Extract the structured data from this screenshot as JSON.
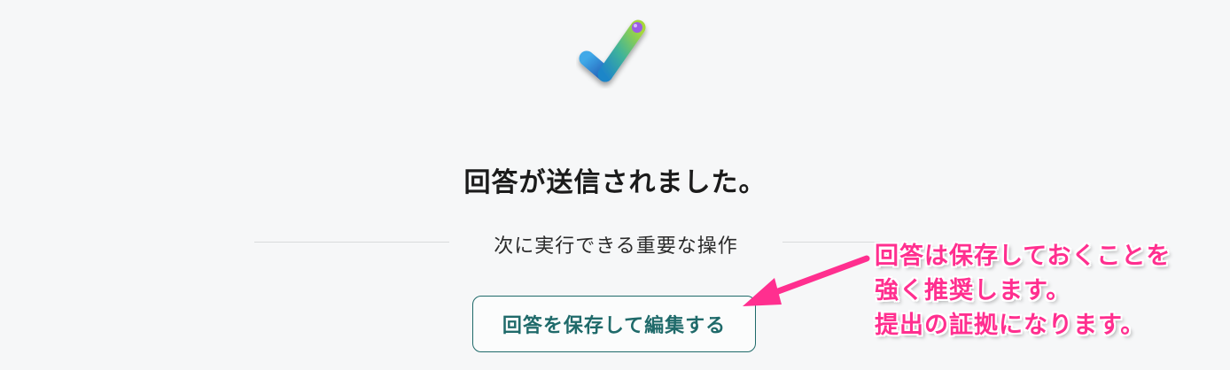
{
  "page": {
    "title": "回答が送信されました。",
    "divider_text": "次に実行できる重要な操作",
    "save_button_label": "回答を保存して編集する"
  },
  "annotation": {
    "lines": [
      "回答は保存しておくことを",
      "強く推奨します。",
      "提出の証拠になります。"
    ],
    "color": "#ff2f8f"
  },
  "icons": {
    "logo": "forms-check-logo-icon",
    "arrow": "pink-arrow-icon"
  },
  "colors": {
    "background": "#f6f7f8",
    "button_accent": "#1f6a6a",
    "title_text": "#1b1b1b"
  }
}
